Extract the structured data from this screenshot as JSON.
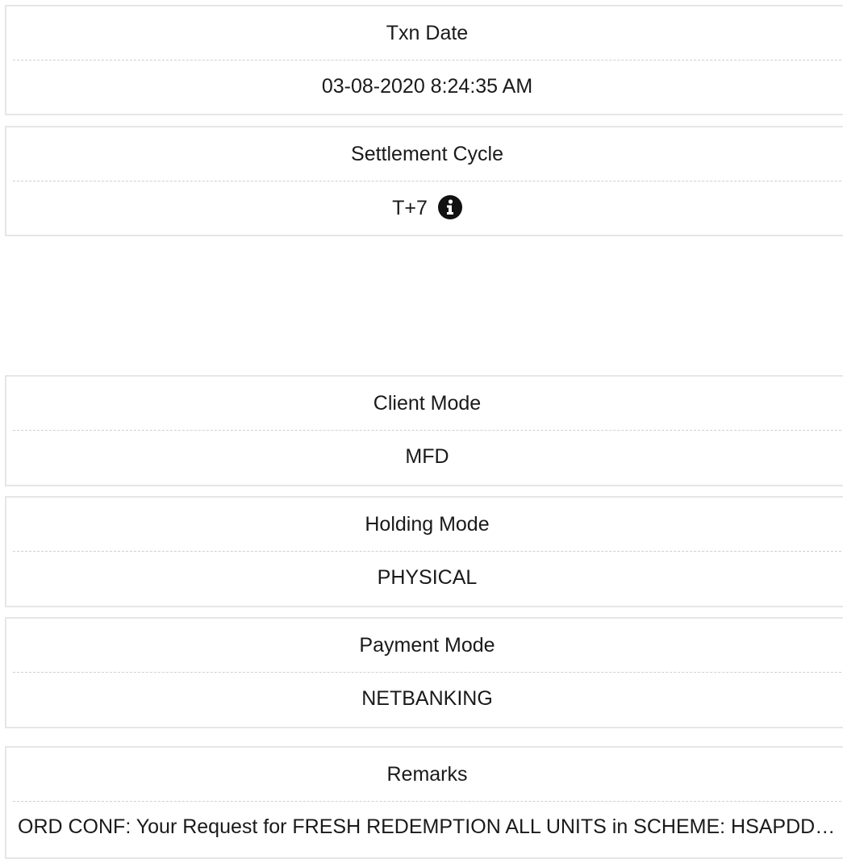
{
  "fields": {
    "txn_date": {
      "label": "Txn Date",
      "value": "03-08-2020 8:24:35 AM"
    },
    "settlement_cycle": {
      "label": "Settlement Cycle",
      "value": "T+7",
      "icon": "info-icon"
    },
    "client_mode": {
      "label": "Client Mode",
      "value": "MFD"
    },
    "holding_mode": {
      "label": "Holding Mode",
      "value": "PHYSICAL"
    },
    "payment_mode": {
      "label": "Payment Mode",
      "value": "NETBANKING"
    },
    "remarks": {
      "label": "Remarks",
      "value": "ORD CONF: Your Request for FRESH REDEMPTION ALL UNITS in SCHEME: HSAPDDP..."
    }
  }
}
